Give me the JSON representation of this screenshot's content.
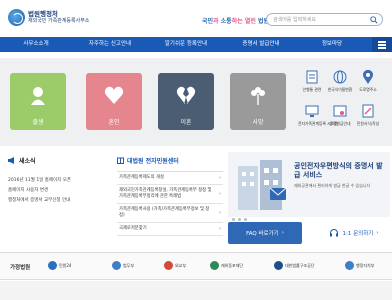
{
  "header": {
    "logo_title": "법원행정처",
    "logo_subtitle": "재외국민 가족관계등록사무소",
    "slogan_part1": "국민",
    "slogan_part2": "과 ",
    "slogan_part3": "소통",
    "slogan_part4": "하는 열린 ",
    "slogan_part5": "법원",
    "search_placeholder": "검색어를 입력하세요"
  },
  "nav": {
    "items": [
      "사무소소개",
      "자주하는 신고안내",
      "알기쉬운 등록안내",
      "증명서 발급안내",
      "정보마당"
    ]
  },
  "quick": {
    "tiles": [
      {
        "label": "출생",
        "color": "#9ccc6a",
        "icon": "baby-icon"
      },
      {
        "label": "혼인",
        "color": "#e5858e",
        "icon": "heart-icon"
      },
      {
        "label": "이혼",
        "color": "#4a5d72",
        "icon": "broken-heart-icon"
      },
      {
        "label": "사망",
        "color": "#9a9a9a",
        "icon": "flower-icon"
      }
    ],
    "mini": [
      {
        "label": "안행통 관련",
        "icon": "document-icon"
      },
      {
        "label": "한국식이름변환",
        "icon": "globe-icon"
      },
      {
        "label": "도로명주소",
        "icon": "map-pin-icon"
      },
      {
        "label": "전자가족관계등록 시스템",
        "icon": "computer-icon"
      },
      {
        "label": "증명발급안내",
        "icon": "certificate-icon"
      },
      {
        "label": "민원서식/작성",
        "icon": "form-icon"
      }
    ]
  },
  "notice": {
    "title": "새소식",
    "items": [
      "2016년 11월 1일 홈페이지 오픈",
      "홈페이지 사용자 변경",
      "행정처에서 증명서 교부신청 안내"
    ]
  },
  "center": {
    "title": "대법원 전자민원센터",
    "items": [
      "가족관계등록제도의 개설",
      "재외국민가족관계등록창설, 가족관계등록부 정정 및 가족관계등록부정리에 관한 특례법",
      "가족관계등록사용 (가족/가족관계등록부정보 및 정정)",
      "국제로저분찾기"
    ]
  },
  "banner": {
    "title": "공인전자우편방식의 증명서 발급 서비스",
    "subtitle": "재외공관에서 편리하게 발급 한글 수 있습니다"
  },
  "actions": {
    "faq_label": "FAQ 바로가기",
    "faq_chevron": "›",
    "inquiry_label": "1:1 문의하기",
    "inquiry_chevron": "›"
  },
  "related": {
    "label": "가정법원",
    "partners": [
      {
        "label": "민원24",
        "color": "#2a6fc1"
      },
      {
        "label": "법무부",
        "color": "#3d7ec7"
      },
      {
        "label": "외교부",
        "color": "#d14a3a"
      },
      {
        "label": "재외동포재단",
        "color": "#2b8a5a"
      },
      {
        "label": "대한법률구조공단",
        "color": "#1f4e8c"
      },
      {
        "label": "행정자치부",
        "color": "#3d7ec7"
      }
    ]
  }
}
